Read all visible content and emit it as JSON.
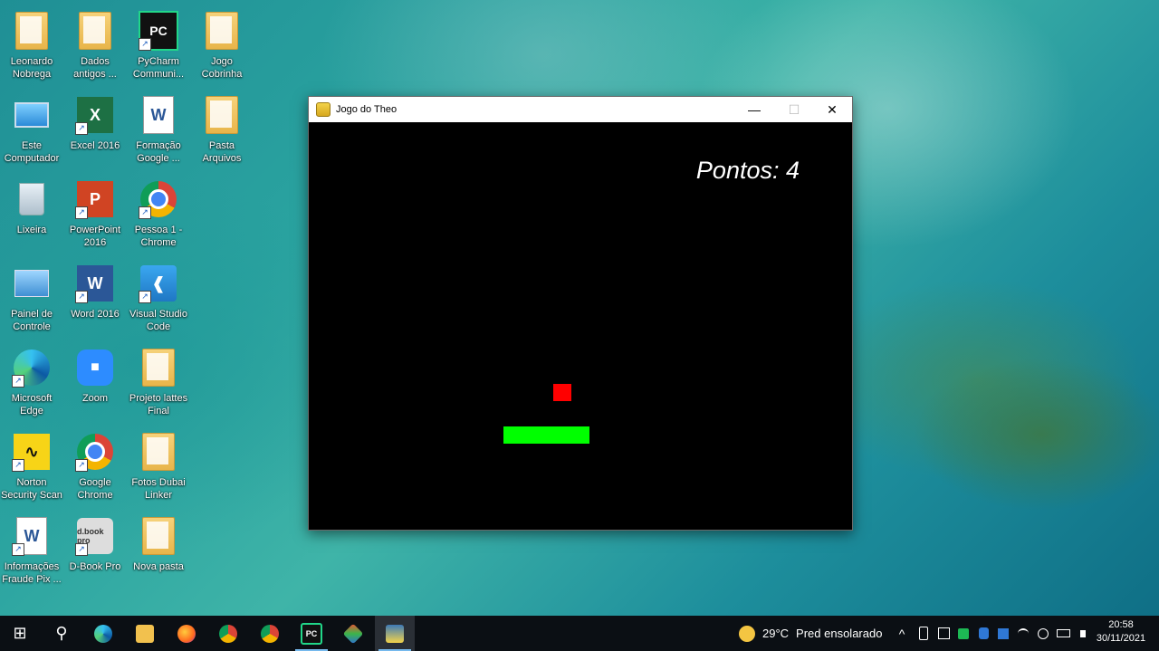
{
  "desktop": {
    "icons": [
      {
        "label": "Leonardo\nNobrega"
      },
      {
        "label": "Dados\nantigos ..."
      },
      {
        "label": "PyCharm\nCommuni..."
      },
      {
        "label": "Jogo\nCobrinha"
      },
      {
        "label": "Este\nComputador"
      },
      {
        "label": "Excel 2016"
      },
      {
        "label": "Formação\nGoogle ..."
      },
      {
        "label": "Pasta\nArquivos"
      },
      {
        "label": "Lixeira"
      },
      {
        "label": "PowerPoint\n2016"
      },
      {
        "label": "Pessoa 1 -\nChrome"
      },
      {
        "label": "Painel de\nControle"
      },
      {
        "label": "Word 2016"
      },
      {
        "label": "Visual Studio\nCode"
      },
      {
        "label": "Microsoft\nEdge"
      },
      {
        "label": "Zoom"
      },
      {
        "label": "Projeto lattes\nFinal"
      },
      {
        "label": "Norton\nSecurity Scan"
      },
      {
        "label": "Google\nChrome"
      },
      {
        "label": "Fotos Dubai\nLinker"
      },
      {
        "label": "Informações\nFraude Pix ..."
      },
      {
        "label": "D-Book Pro"
      },
      {
        "label": "Nova pasta"
      }
    ],
    "icon_glyphs": {
      "pycharm": "PC",
      "excel": "X",
      "word": "W",
      "powerpoint": "P",
      "dbook": "d.book pro"
    }
  },
  "window": {
    "title": "Jogo do Theo",
    "minimize": "—",
    "maximize": "☐",
    "close": "✕",
    "score_text": "Pontos: 4"
  },
  "taskbar": {
    "start": "⊞",
    "search": "⚲",
    "pycharm": "PC",
    "weather_temp": "29°C",
    "weather_desc": "Pred ensolarado",
    "tray_chevron": "^",
    "time": "20:58",
    "date": "30/11/2021"
  },
  "colors": {
    "snake": "#00ff00",
    "food": "#ff0000",
    "game_bg": "#000000",
    "taskbar_bg": "#0b0f14"
  }
}
